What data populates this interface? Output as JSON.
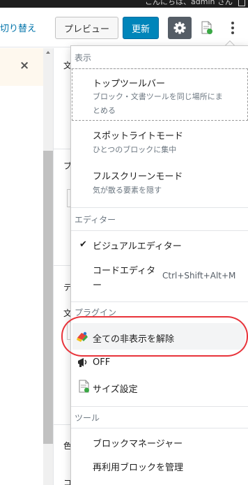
{
  "header": {
    "top_strip_text": "こんにちは、admin さん",
    "switch_link": "切り替え",
    "preview_button": "プレビュー",
    "update_button": "更新",
    "accent_color": "#0085ba"
  },
  "behind": {
    "close_symbol": "×",
    "chars": [
      "文",
      "ブ",
      "テ",
      "文",
      "色",
      "コ"
    ]
  },
  "menu": {
    "view": {
      "label": "表示",
      "items": [
        {
          "title": "トップツールバー",
          "desc_line1": "ブロック・文書ツールを同じ場所にま",
          "desc_line2": "とめる"
        },
        {
          "title": "スポットライトモード",
          "desc": "ひとつのブロックに集中"
        },
        {
          "title": "フルスクリーンモード",
          "desc": "気が散る要素を隠す"
        }
      ]
    },
    "editor": {
      "label": "エディター",
      "check_mark": "✔",
      "visual": "ビジュアルエディター",
      "code_line1": "コードエディタ",
      "code_line2": "ー",
      "code_shortcut": "Ctrl+Shift+Alt+M"
    },
    "plugins": {
      "label": "プラグイン",
      "items": [
        {
          "label": "全ての非表示を解除",
          "icon": "multicolor-plugin-icon"
        },
        {
          "label": "OFF",
          "icon": "megaphone-icon"
        },
        {
          "label": "サイズ設定",
          "icon": "document-icon"
        }
      ]
    },
    "tools": {
      "label": "ツール",
      "items": [
        "ブロックマネージャー",
        "再利用ブロックを管理"
      ]
    }
  }
}
